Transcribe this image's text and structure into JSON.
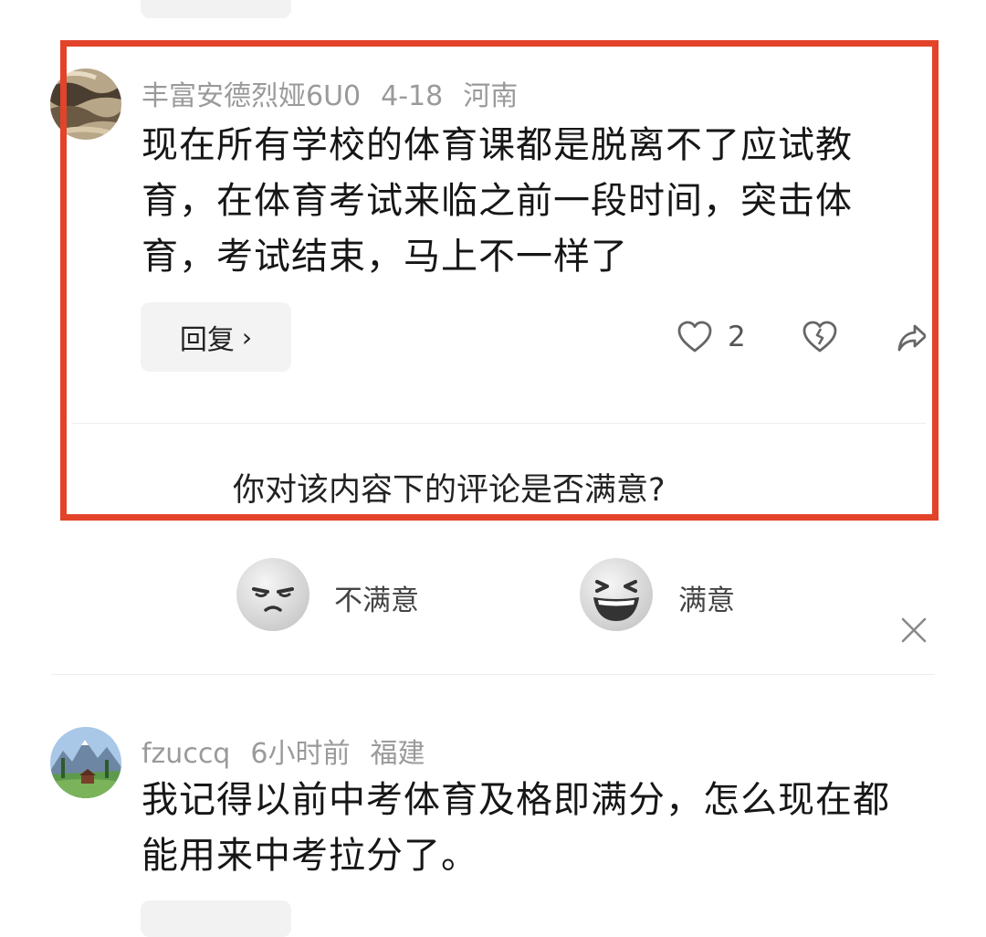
{
  "comments": [
    {
      "username": "丰富安德烈娅6U0",
      "date": "4-18",
      "location": "河南",
      "text": "现在所有学校的体育课都是脱离不了应试教育，在体育考试来临之前一段时间，突击体育，考试结束，马上不一样了",
      "reply_label": "回复",
      "likes": "2"
    },
    {
      "username": "fzuccq",
      "date": "6小时前",
      "location": "福建",
      "text": "我记得以前中考体育及格即满分，怎么现在都能用来中考拉分了。"
    }
  ],
  "survey": {
    "question": "你对该内容下的评论是否满意?",
    "options": [
      {
        "label": "不满意",
        "icon": "unhappy-face-icon"
      },
      {
        "label": "满意",
        "icon": "laughing-face-icon"
      }
    ],
    "close_icon": "close-icon"
  },
  "colors": {
    "highlight_border": "#e2432a",
    "meta_text": "#9a9a9a",
    "pill_bg": "#f3f3f3"
  }
}
